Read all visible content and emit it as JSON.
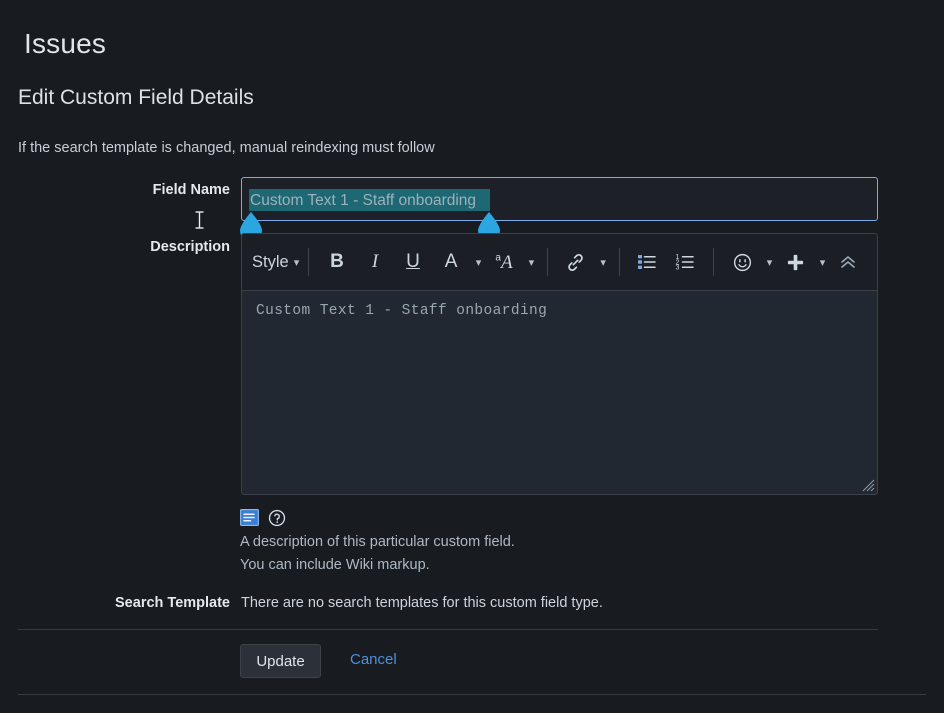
{
  "header": {
    "app_title": "Issues",
    "page_title": "Edit Custom Field Details",
    "subtitle": "If the search template is changed, manual reindexing must follow"
  },
  "form": {
    "field_name": {
      "label": "Field Name",
      "value": "Custom Text 1 - Staff onboarding",
      "selected_text": "Custom Text 1 - Staff onboarding",
      "focus_border_color": "#7ea8e8",
      "selection_color": "#1d6873",
      "handle_color": "#2ba6e0"
    },
    "description": {
      "label": "Description",
      "value": "Custom Text 1 - Staff onboarding",
      "help_line_1": "A description of this particular custom field.",
      "help_line_2": "You can include Wiki markup.",
      "toolbar": {
        "style_label": "Style",
        "bold_label": "B",
        "italic_label": "I",
        "underline_label": "U",
        "font_color_label": "A",
        "font_color_swatch": "#e02020",
        "highlight_sup": "a",
        "highlight_label": "A",
        "items": [
          {
            "name": "style-dropdown",
            "label": "Style"
          },
          {
            "name": "bold-button",
            "label": "B"
          },
          {
            "name": "italic-button",
            "label": "I"
          },
          {
            "name": "underline-button",
            "label": "U"
          },
          {
            "name": "font-color-button",
            "label": "A"
          },
          {
            "name": "highlight-color-button",
            "label": "A"
          },
          {
            "name": "link-button",
            "label": ""
          },
          {
            "name": "bulleted-list-button",
            "label": ""
          },
          {
            "name": "numbered-list-button",
            "label": ""
          },
          {
            "name": "emoji-button",
            "label": ""
          },
          {
            "name": "insert-more-button",
            "label": ""
          },
          {
            "name": "collapse-toolbar-button",
            "label": ""
          }
        ]
      },
      "below_icons": [
        {
          "name": "preview-icon",
          "color": "#3b7fd4"
        },
        {
          "name": "help-icon",
          "color": "#d3dae1"
        }
      ]
    },
    "search_template": {
      "label": "Search Template",
      "value": "There are no search templates for this custom field type."
    }
  },
  "footer": {
    "update_label": "Update",
    "cancel_label": "Cancel",
    "cancel_color": "#4d90dd"
  }
}
